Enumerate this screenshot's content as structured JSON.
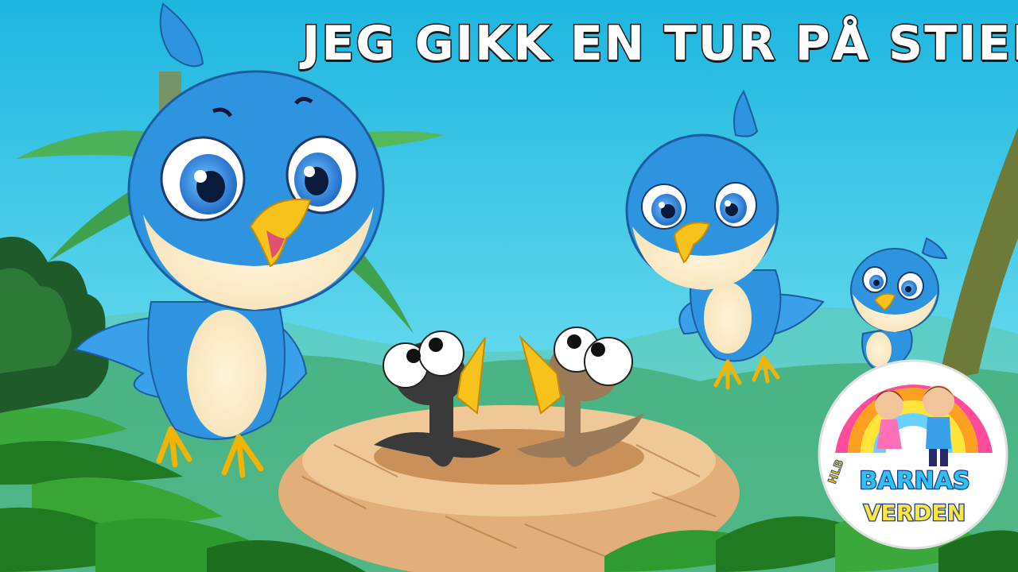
{
  "title": "JEG GIKK EN TUR PÅ STIEN",
  "logo": {
    "small": "HLB",
    "line1": "BARNAS",
    "line2": "VERDEN"
  },
  "colors": {
    "sky_top": "#20b8e0",
    "sky_bottom": "#9be8f2",
    "bird_blue": "#2f94e0",
    "bird_belly": "#fdebc4",
    "beak": "#f7c21c",
    "leaf_dark": "#1e7a1e",
    "leaf_light": "#4db23a",
    "nest": "#e8b888"
  }
}
